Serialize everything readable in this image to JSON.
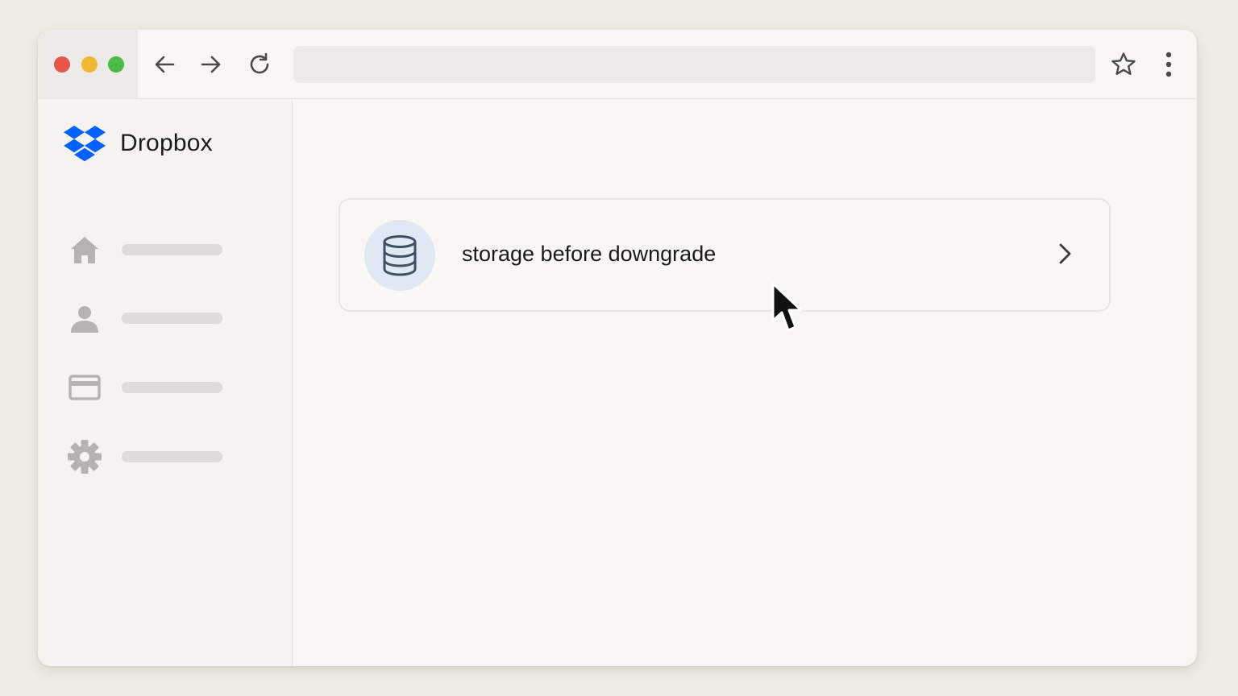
{
  "browser": {
    "address_value": "",
    "icons": [
      "back-arrow-icon",
      "forward-arrow-icon",
      "reload-icon",
      "bookmark-star-icon",
      "more-vertical-icon"
    ]
  },
  "sidebar": {
    "brand": "Dropbox",
    "brand_color": "#0061fe",
    "items": [
      {
        "icon": "home-icon",
        "label": ""
      },
      {
        "icon": "person-icon",
        "label": ""
      },
      {
        "icon": "credit-card-icon",
        "label": ""
      },
      {
        "icon": "gear-icon",
        "label": ""
      }
    ]
  },
  "main": {
    "card": {
      "icon": "database-icon",
      "label": "storage before downgrade",
      "chevron": "chevron-right-icon"
    }
  }
}
